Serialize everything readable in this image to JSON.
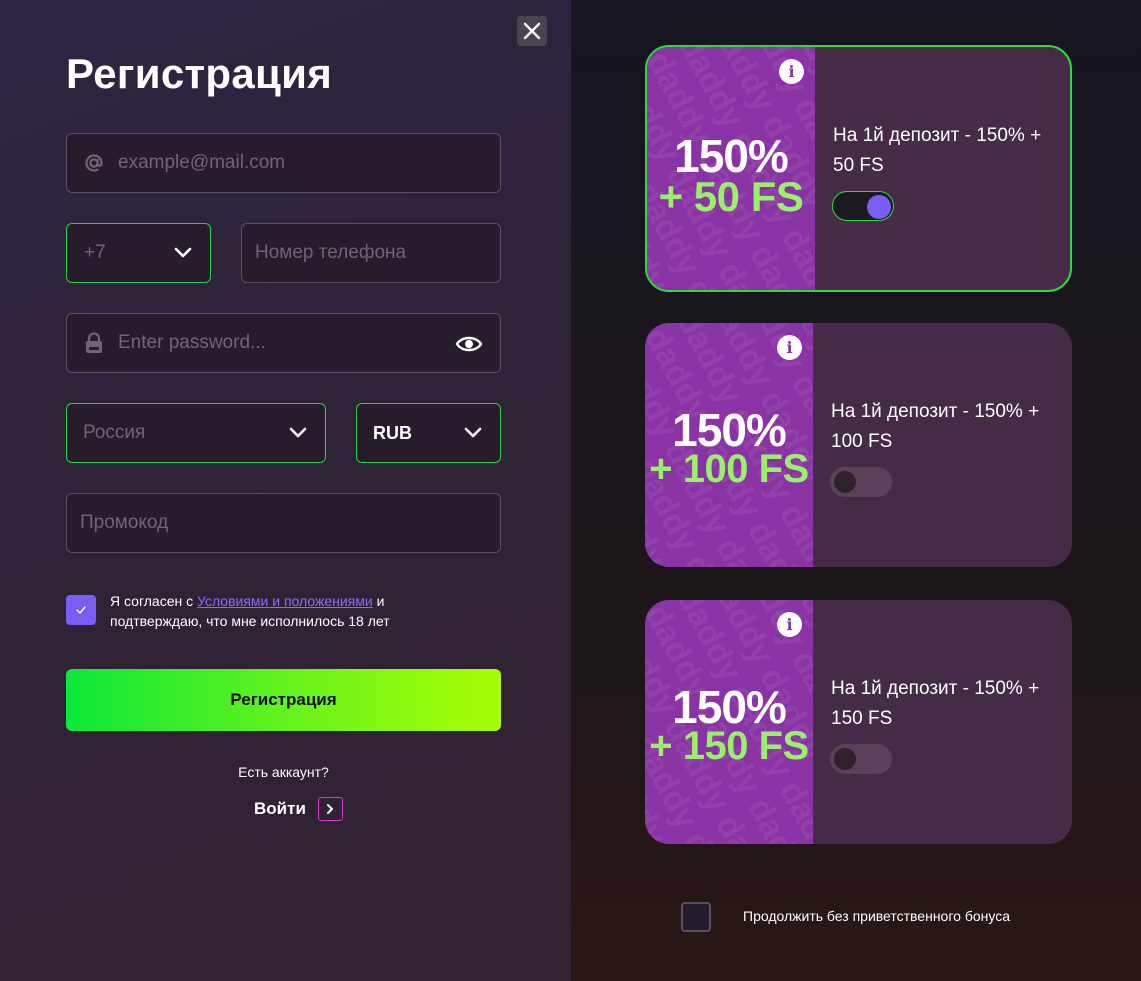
{
  "form": {
    "title": "Регистрация",
    "email_placeholder": "example@mail.com",
    "phone_code": "+7",
    "phone_placeholder": "Номер телефона",
    "password_placeholder": "Enter password...",
    "country": "Россия",
    "currency": "RUB",
    "promo_placeholder": "Промокод",
    "terms_prefix": "Я согласен с ",
    "terms_link": "Условиями и положениями",
    "terms_suffix": " и подтверждаю, что мне исполнилось 18 лет",
    "terms_checked": true,
    "register_label": "Регистрация",
    "have_account": "Есть аккаунт?",
    "login_label": "Войти"
  },
  "bonuses": [
    {
      "pct": "150%",
      "fs": "+ 50 FS",
      "desc": "На 1й депозит - 150% + 50 FS",
      "enabled": true
    },
    {
      "pct": "150%",
      "fs": "+ 100 FS",
      "desc": "На 1й депозит - 150% + 100 FS",
      "enabled": false
    },
    {
      "pct": "150%",
      "fs": "+ 150 FS",
      "desc": "На 1й депозит - 150% + 150 FS",
      "enabled": false
    }
  ],
  "watermark": "daddy",
  "no_bonus_label": "Продолжить без приветственного бонуса",
  "colors": {
    "accent_green": "#2adc3c",
    "accent_purple": "#7b5cf5",
    "card_bg": "#452b48",
    "card_image_bg": "#8a33a5",
    "fs_green": "#9af06a"
  }
}
